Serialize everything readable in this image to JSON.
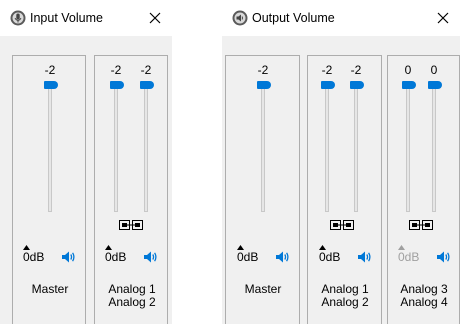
{
  "input_window": {
    "title": "Input Volume",
    "icon": "microphone-icon",
    "master": {
      "value": "-2",
      "db": "0dB",
      "label": "Master",
      "level_pct": 0
    },
    "analog_12": {
      "values": [
        "-2",
        "-2"
      ],
      "db": "0dB",
      "label": "Analog 1\nAnalog 2",
      "levels_pct": [
        0,
        0
      ]
    }
  },
  "output_window": {
    "title": "Output Volume",
    "icon": "speaker-output-icon",
    "master": {
      "value": "-2",
      "db": "0dB",
      "label": "Master",
      "level_pct": 0
    },
    "analog_12": {
      "values": [
        "-2",
        "-2"
      ],
      "db": "0dB",
      "label": "Analog 1\nAnalog 2",
      "levels_pct": [
        0,
        0
      ]
    },
    "analog_34": {
      "values": [
        "0",
        "0"
      ],
      "db": "0dB",
      "label": "Analog 3\nAnalog 4",
      "levels_pct": [
        0,
        0
      ],
      "db_disabled": true
    }
  },
  "colors": {
    "accent": "#0078d7",
    "panel_bg": "#f0f0f0",
    "border": "#adadad",
    "disabled_text": "#a0a0a0"
  }
}
